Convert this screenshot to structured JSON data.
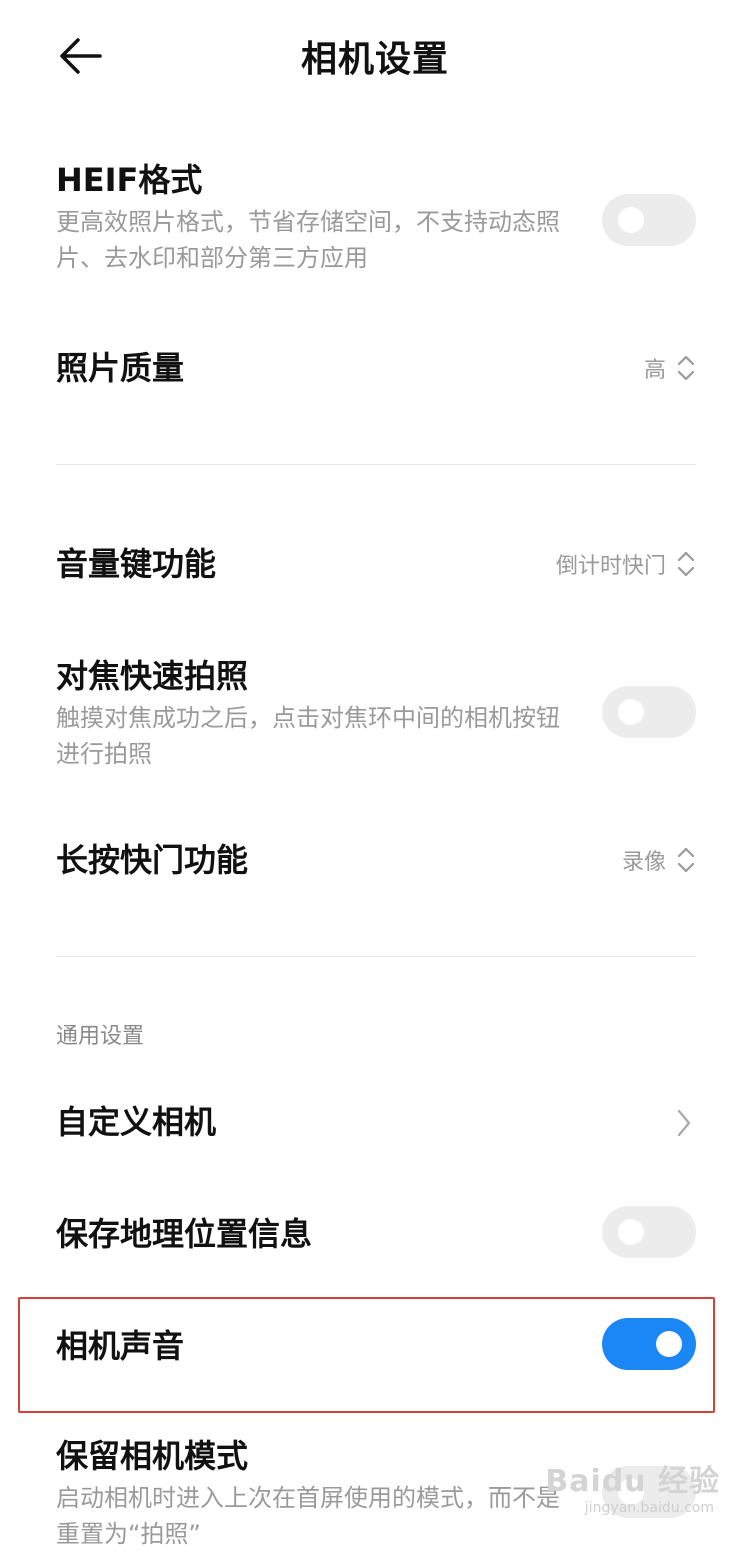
{
  "header": {
    "title": "相机设置"
  },
  "settings": {
    "heif": {
      "title": "HEIF格式",
      "subtitle": "更高效照片格式，节省存储空间，不支持动态照片、去水印和部分第三方应用",
      "enabled": false
    },
    "photo_quality": {
      "title": "照片质量",
      "value": "高"
    },
    "volume_key": {
      "title": "音量键功能",
      "value": "倒计时快门"
    },
    "focus_shoot": {
      "title": "对焦快速拍照",
      "subtitle": "触摸对焦成功之后，点击对焦环中间的相机按钮进行拍照",
      "enabled": false
    },
    "long_press_shutter": {
      "title": "长按快门功能",
      "value": "录像"
    }
  },
  "general": {
    "section_title": "通用设置",
    "custom_camera": {
      "title": "自定义相机"
    },
    "save_location": {
      "title": "保存地理位置信息",
      "enabled": false
    },
    "camera_sound": {
      "title": "相机声音",
      "enabled": true
    },
    "keep_mode": {
      "title": "保留相机模式",
      "subtitle": "启动相机时进入上次在首屏使用的模式，而不是重置为“拍照”",
      "enabled": false
    }
  },
  "colors": {
    "accent": "#1b86f6",
    "highlight_border": "#d8413a",
    "toggle_off": "#ececec"
  },
  "watermark": {
    "text": "Baidu 经验",
    "sub": "jingyan.baidu.com"
  }
}
